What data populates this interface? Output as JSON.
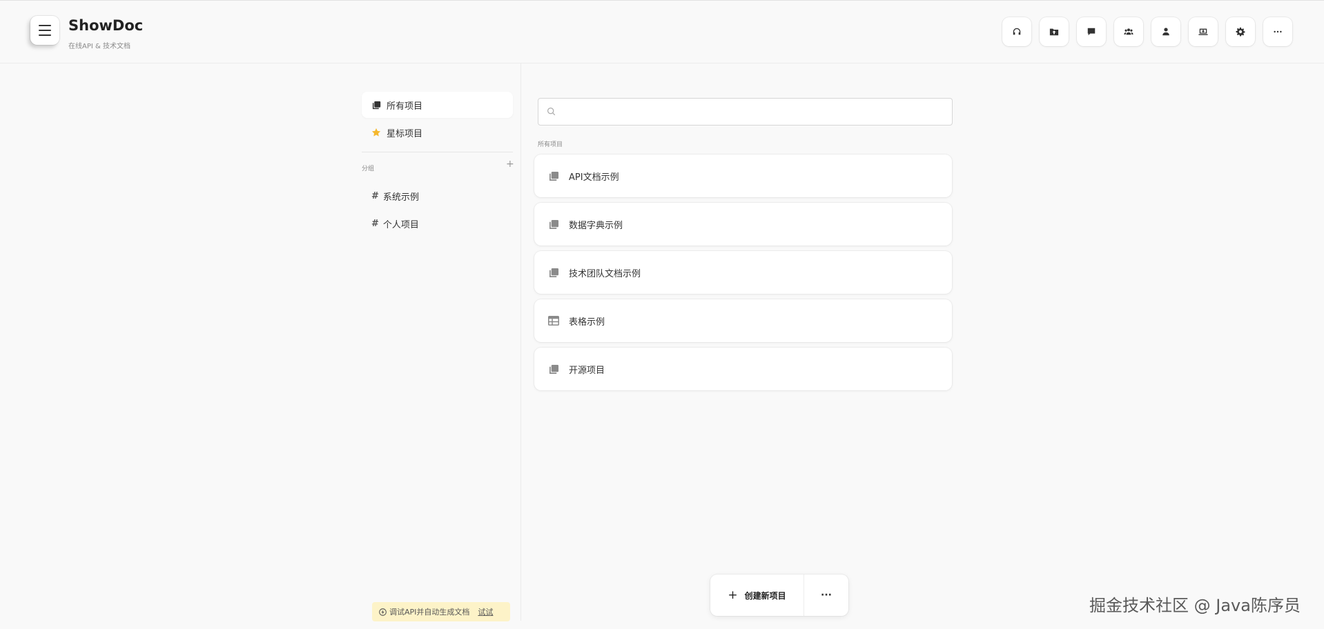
{
  "header": {
    "title": "ShowDoc",
    "subtitle": "在线API & 技术文档",
    "actions": [
      {
        "icon": "headphones-icon"
      },
      {
        "icon": "folder-upload-icon"
      },
      {
        "icon": "message-icon"
      },
      {
        "icon": "team-icon"
      },
      {
        "icon": "user-icon"
      },
      {
        "icon": "download-icon"
      },
      {
        "icon": "gear-icon"
      },
      {
        "icon": "more-icon"
      }
    ]
  },
  "sidebar": {
    "items": [
      {
        "label": "所有项目",
        "icon": "copy-icon",
        "active": true
      },
      {
        "label": "星标项目",
        "icon": "star-icon",
        "active": false
      }
    ],
    "group_label": "分组",
    "group_add": "+",
    "groups": [
      {
        "label": "系统示例"
      },
      {
        "label": "个人项目"
      }
    ]
  },
  "main": {
    "search_placeholder": "",
    "list_label": "所有项目",
    "projects": [
      {
        "name": "API文档示例",
        "icon": "copy-icon"
      },
      {
        "name": "数据字典示例",
        "icon": "copy-icon"
      },
      {
        "name": "技术团队文档示例",
        "icon": "copy-icon"
      },
      {
        "name": "表格示例",
        "icon": "table-icon"
      },
      {
        "name": "开源项目",
        "icon": "copy-icon"
      }
    ]
  },
  "promo": {
    "text": "调试API并自动生成文档",
    "link": "试试"
  },
  "bottom_bar": {
    "create_label": "创建新项目",
    "more_label": "···"
  },
  "watermark": "掘金技术社区 @ Java陈序员",
  "colors": {
    "accent_star": "#f5b82e",
    "promo_bg": "#fdf3c8"
  }
}
